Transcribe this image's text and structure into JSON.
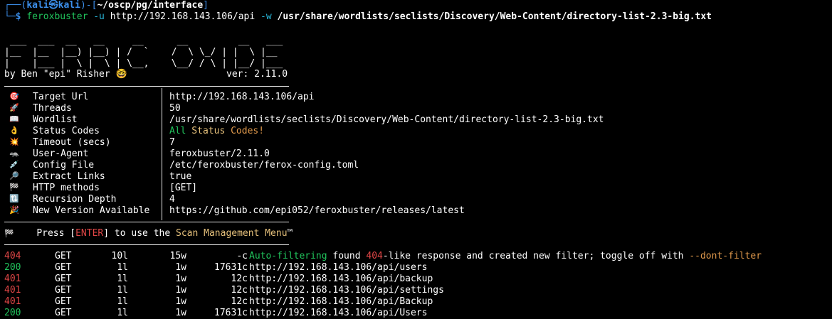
{
  "prompt": {
    "user": "kali",
    "host": "kali",
    "cwd": "~/oscp/pg/interface",
    "command_name": "feroxbuster",
    "arg_u_flag": "-u",
    "arg_u": "http://192.168.143.106/api",
    "arg_w_flag": "-w",
    "arg_w": "/usr/share/wordlists/seclists/Discovery/Web-Content/directory-list-2.3-big.txt"
  },
  "banner": {
    "ascii": [
      " ___  ___  __   __     __      __         __   ___",
      "|__  |__  |__) |__) | /  `    /  \\ \\_/ | |  \\ |__",
      "|    |___ |  \\ |  \\ | \\__,    \\__/ / \\ | |__/ |___"
    ],
    "byline": "by Ben \"epi\" Risher 🤓",
    "version": "ver: 2.11.0"
  },
  "config": [
    {
      "icon": "🎯",
      "icon_name": "target-icon",
      "key": "Target Url",
      "value": "http://192.168.143.106/api"
    },
    {
      "icon": "🚀",
      "icon_name": "rocket-icon",
      "key": "Threads",
      "value": "50"
    },
    {
      "icon": "📖",
      "icon_name": "book-icon",
      "key": "Wordlist",
      "value": "/usr/share/wordlists/seclists/Discovery/Web-Content/directory-list-2.3-big.txt"
    },
    {
      "icon": "👌",
      "icon_name": "ok-hand-icon",
      "key": "Status Codes",
      "value": "",
      "status_all": "All Status Codes!"
    },
    {
      "icon": "💥",
      "icon_name": "collision-icon",
      "key": "Timeout (secs)",
      "value": "7"
    },
    {
      "icon": "🦡",
      "icon_name": "badger-icon",
      "key": "User-Agent",
      "value": "feroxbuster/2.11.0"
    },
    {
      "icon": "💉",
      "icon_name": "syringe-icon",
      "key": "Config File",
      "value": "/etc/feroxbuster/ferox-config.toml"
    },
    {
      "icon": "🔎",
      "icon_name": "magnifier-icon",
      "key": "Extract Links",
      "value": "true"
    },
    {
      "icon": "🏁",
      "icon_name": "flag-icon",
      "key": "HTTP methods",
      "value": "[GET]"
    },
    {
      "icon": "🔃",
      "icon_name": "recursion-icon",
      "key": "Recursion Depth",
      "value": "4"
    },
    {
      "icon": "🎉",
      "icon_name": "party-icon",
      "key": "New Version Available",
      "value": "https://github.com/epi052/feroxbuster/releases/latest"
    }
  ],
  "press": {
    "icon": "🏁",
    "pre": "Press [",
    "key": "ENTER",
    "mid": "] to use the ",
    "menu": "Scan Management Menu",
    "tm": "™"
  },
  "results": [
    {
      "status": "404",
      "method": "GET",
      "lines": "10l",
      "words": "15w",
      "chars": "-c",
      "message_parts": [
        {
          "t": "Auto-filtering",
          "c": "green"
        },
        {
          "t": " found ",
          "c": "white"
        },
        {
          "t": "404",
          "c": "red"
        },
        {
          "t": "-like response and created new filter; toggle off with ",
          "c": "white"
        },
        {
          "t": "--dont-filter",
          "c": "orange"
        }
      ]
    },
    {
      "status": "200",
      "method": "GET",
      "lines": "1l",
      "words": "1w",
      "chars": "17631c",
      "url": "http://192.168.143.106/api/users"
    },
    {
      "status": "401",
      "method": "GET",
      "lines": "1l",
      "words": "1w",
      "chars": "12c",
      "url": "http://192.168.143.106/api/backup"
    },
    {
      "status": "401",
      "method": "GET",
      "lines": "1l",
      "words": "1w",
      "chars": "12c",
      "url": "http://192.168.143.106/api/settings"
    },
    {
      "status": "401",
      "method": "GET",
      "lines": "1l",
      "words": "1w",
      "chars": "12c",
      "url": "http://192.168.143.106/api/Backup"
    },
    {
      "status": "200",
      "method": "GET",
      "lines": "1l",
      "words": "1w",
      "chars": "17631c",
      "url": "http://192.168.143.106/api/Users"
    }
  ],
  "colors": {
    "background": "#000000",
    "prompt_blue": "#3b8eea",
    "ok_green": "#21c55d",
    "error_red": "#e04646",
    "highlight_yellow": "#e5c07b",
    "flag_orange": "#e0994c",
    "cyan": "#29b8db"
  }
}
